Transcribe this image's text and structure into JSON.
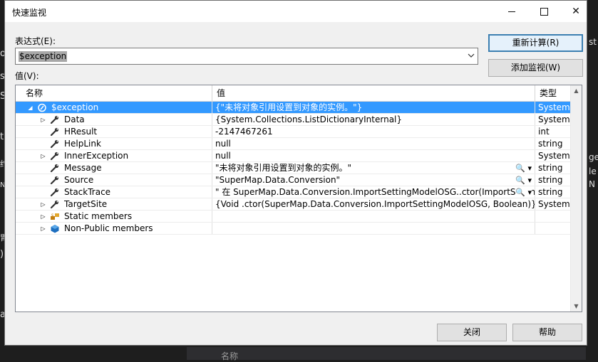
{
  "background": {
    "left_glyphs": [
      "o",
      "s",
      "S",
      "t",
      "约",
      "N",
      "胃",
      ")",
      "a"
    ],
    "right_glyphs": [
      "st",
      "ge",
      "le",
      "N"
    ],
    "bottom_tab_label": "名称"
  },
  "dialog": {
    "title": "快速监视",
    "expression_label": "表达式(E):",
    "expression_value": "$exception",
    "value_label": "值(V):",
    "recalc_button": "重新计算(R)",
    "add_watch_button": "添加监视(W)",
    "close_button": "关闭",
    "help_button": "帮助"
  },
  "grid": {
    "columns": [
      "名称",
      "值",
      "类型"
    ],
    "rows": [
      {
        "name": "$exception",
        "value": "{\"未将对象引用设置到对象的实例。\"}",
        "type": "System.N",
        "expand": "◢",
        "icon": "exception-icon"
      },
      {
        "name": "Data",
        "value": "{System.Collections.ListDictionaryInternal}",
        "type": "System.C",
        "expand": "▷",
        "icon": "property-wrench-icon"
      },
      {
        "name": "HResult",
        "value": "-2147467261",
        "type": "int",
        "expand": "",
        "icon": "property-wrench-icon"
      },
      {
        "name": "HelpLink",
        "value": "null",
        "type": "string",
        "expand": "",
        "icon": "property-wrench-icon"
      },
      {
        "name": "InnerException",
        "value": "null",
        "type": "System.E",
        "expand": "▷",
        "icon": "property-wrench-icon"
      },
      {
        "name": "Message",
        "value": "\"未将对象引用设置到对象的实例。\"",
        "type": "string",
        "expand": "",
        "icon": "property-wrench-icon",
        "magnifier": "🔍 ▾"
      },
      {
        "name": "Source",
        "value": "\"SuperMap.Data.Conversion\"",
        "type": "string",
        "expand": "",
        "icon": "property-wrench-icon",
        "magnifier": "🔍 ▾"
      },
      {
        "name": "StackTrace",
        "value": "\"   在 SuperMap.Data.Conversion.ImportSettingModelOSG..ctor(ImportSettingM",
        "type": "string",
        "expand": "",
        "icon": "property-wrench-icon",
        "magnifier": "🔍 ▾"
      },
      {
        "name": "TargetSite",
        "value": "{Void .ctor(SuperMap.Data.Conversion.ImportSettingModelOSG, Boolean)}",
        "type": "System.R",
        "expand": "▷",
        "icon": "property-wrench-icon"
      },
      {
        "name": "Static members",
        "value": "",
        "type": "",
        "expand": "▷",
        "icon": "static-members-icon"
      },
      {
        "name": "Non-Public members",
        "value": "",
        "type": "",
        "expand": "▷",
        "icon": "non-public-members-icon"
      }
    ]
  },
  "colors": {
    "selection": "#3399ff",
    "default_button_border": "#3c7fb1",
    "dialog_bg": "#f0f0f0"
  }
}
